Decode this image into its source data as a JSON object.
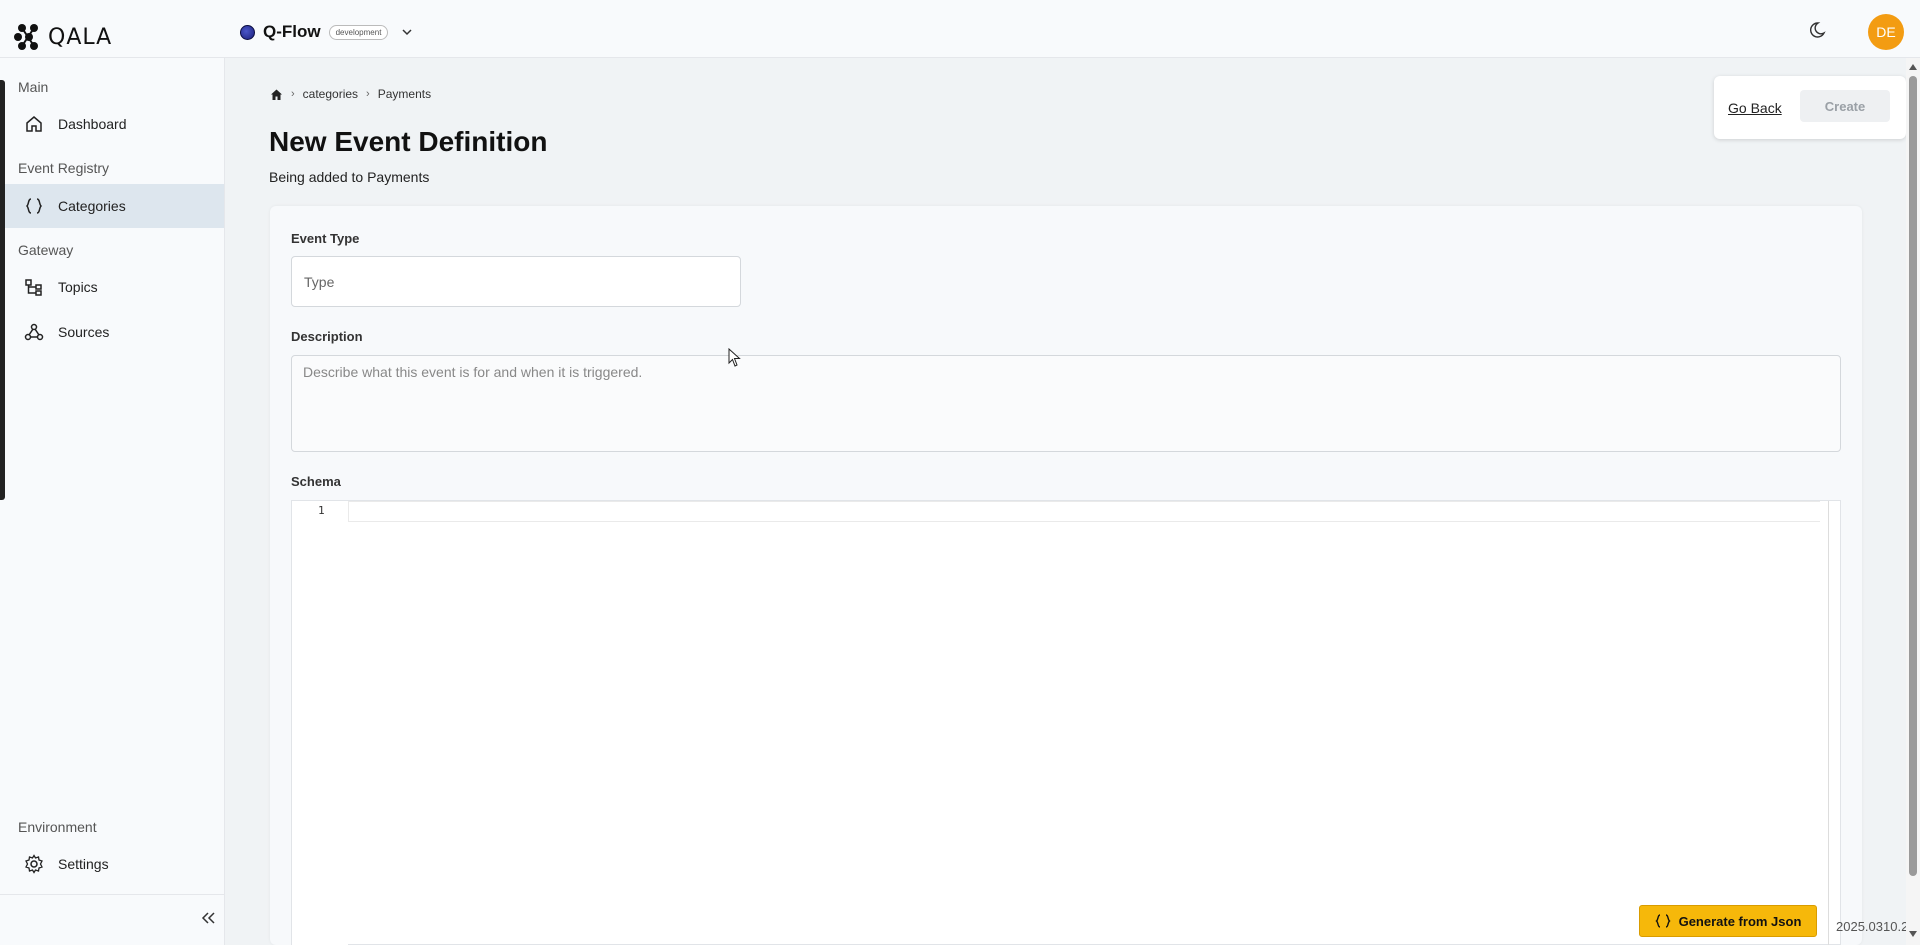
{
  "header": {
    "logo_text": "QALA",
    "project_name": "Q-Flow",
    "environment_badge": "development",
    "avatar_initials": "DE"
  },
  "sidebar": {
    "sections": [
      {
        "label": "Main",
        "items": [
          {
            "label": "Dashboard",
            "icon": "home-icon"
          }
        ]
      },
      {
        "label": "Event Registry",
        "items": [
          {
            "label": "Categories",
            "icon": "braces-icon",
            "active": true
          }
        ]
      },
      {
        "label": "Gateway",
        "items": [
          {
            "label": "Topics",
            "icon": "topics-icon"
          },
          {
            "label": "Sources",
            "icon": "webhook-icon"
          }
        ]
      },
      {
        "label": "Environment",
        "items": [
          {
            "label": "Settings",
            "icon": "gear-icon"
          }
        ]
      }
    ]
  },
  "breadcrumb": [
    "categories",
    "Payments"
  ],
  "page": {
    "title": "New Event Definition",
    "subtitle": "Being added to Payments"
  },
  "actions": {
    "go_back": "Go Back",
    "create": "Create"
  },
  "form": {
    "event_type_label": "Event Type",
    "event_type_placeholder": "Type",
    "description_label": "Description",
    "description_placeholder": "Describe what this event is for and when it is triggered.",
    "schema_label": "Schema",
    "schema_line_number": "1"
  },
  "generate_button": "Generate from Json",
  "version": "2025.0310.2",
  "colors": {
    "accent": "#f6b80a",
    "avatar": "#f39c12",
    "active_nav": "#dde6ee"
  }
}
